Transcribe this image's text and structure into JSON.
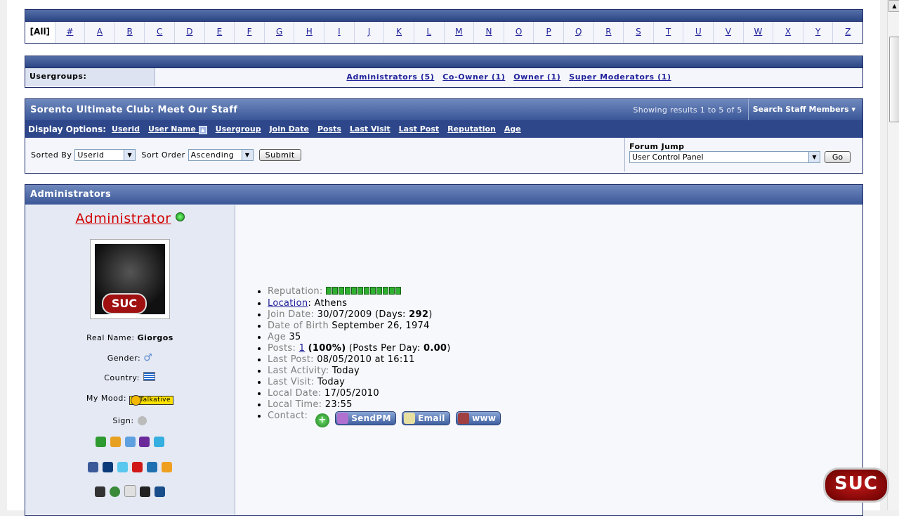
{
  "letters": {
    "all_label": "[All]",
    "items": [
      "#",
      "A",
      "B",
      "C",
      "D",
      "E",
      "F",
      "G",
      "H",
      "I",
      "J",
      "K",
      "L",
      "M",
      "N",
      "O",
      "P",
      "Q",
      "R",
      "S",
      "T",
      "U",
      "V",
      "W",
      "X",
      "Y",
      "Z"
    ]
  },
  "usergroups": {
    "label": "Usergroups:",
    "links": [
      "Administrators (5)",
      "Co-Owner (1)",
      "Owner (1)",
      "Super Moderators (1)"
    ]
  },
  "staff": {
    "title": "Sorento Ultimate Club: Meet Our Staff",
    "showing": "Showing results 1 to 5 of 5",
    "search_label": "Search Staff Members",
    "display_options_label": "Display Options:",
    "display_options": [
      "Userid",
      "User Name",
      "Usergroup",
      "Join Date",
      "Posts",
      "Last Visit",
      "Last Post",
      "Reputation",
      "Age"
    ],
    "sorted_by_label": "Sorted By",
    "sorted_by_value": "Userid",
    "sort_order_label": "Sort Order",
    "sort_order_value": "Ascending",
    "submit_label": "Submit",
    "forum_jump_label": "Forum Jump",
    "forum_jump_value": "User Control Panel",
    "go_label": "Go"
  },
  "admins": {
    "header": "Administrators",
    "username": "Administrator",
    "avatar_logo": "SUC",
    "real_name_label": "Real Name:",
    "real_name": "Giorgos",
    "gender_label": "Gender:",
    "country_label": "Country:",
    "mood_label": "My Mood:",
    "mood_value": "Talkative",
    "sign_label": "Sign:",
    "info": {
      "reputation_label": "Reputation:",
      "location_label": "Location",
      "location_value": ": Athens",
      "join_label": "Join Date:",
      "join_value": "30/07/2009 (Days: ",
      "join_days": "292",
      "birth_label": "Date of Birth",
      "birth_value": "September 26, 1974",
      "age_label": "Age",
      "age_value": "35",
      "posts_label": "Posts:",
      "posts_count": "1",
      "posts_pct": "(100%)",
      "posts_perday_label": "(Posts Per Day: ",
      "posts_perday": "0.00",
      "lastpost_label": "Last Post:",
      "lastpost_value": "08/05/2010 at 16:11",
      "lastactivity_label": "Last Activity:",
      "lastactivity_value": "Today",
      "lastvisit_label": "Last Visit:",
      "lastvisit_value": "Today",
      "localdate_label": "Local Date:",
      "localdate_value": "17/05/2010",
      "localtime_label": "Local Time:",
      "localtime_value": "23:55",
      "contact_label": "Contact:",
      "sendpm": "SendPM",
      "email": "Email",
      "www": "www"
    }
  },
  "footer_logo": "SUC"
}
